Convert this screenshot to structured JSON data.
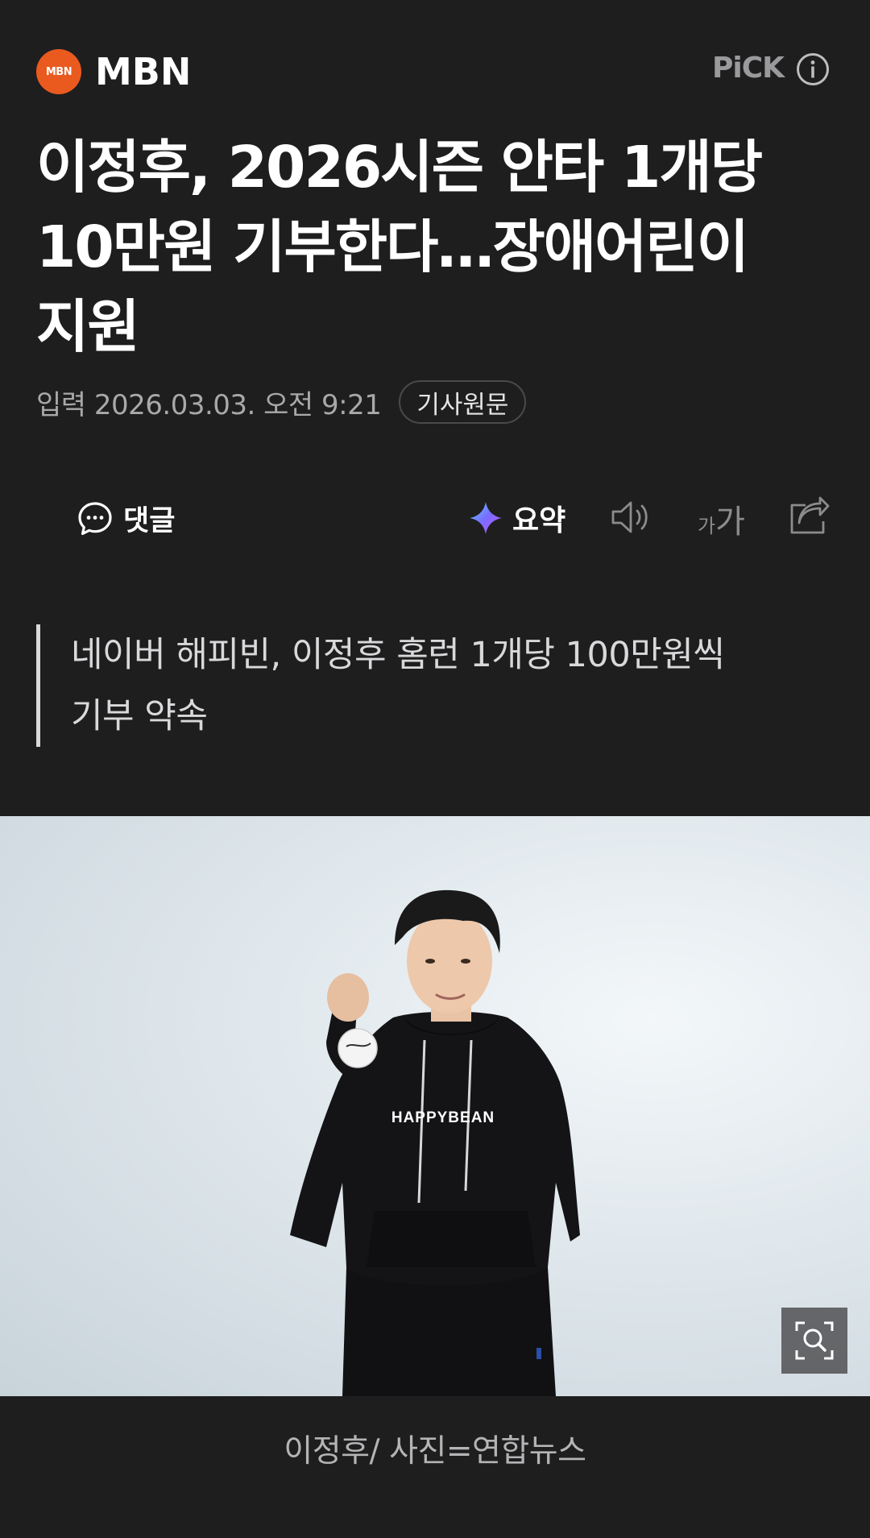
{
  "header": {
    "logo_text": "MBN",
    "press_name": "MBN",
    "pick_label": "PiCK",
    "info_icon": "info-circle-icon"
  },
  "article": {
    "title": "이정후, 2026시즌 안타 1개당\n10만원 기부한다…장애어린이\n지원",
    "date": "입력 2026.03.03. 오전 9:21",
    "origin_button": "기사원문"
  },
  "toolbar": {
    "comment_label": "댓글",
    "summary_label": "요약",
    "font_size_label": "가가",
    "icons": [
      "comment-icon",
      "ai-summary-icon",
      "speaker-icon",
      "font-size-icon",
      "share-icon"
    ]
  },
  "subheading": "네이버 해피빈, 이정후 홈런 1개당 100만원씩\n기부 약속",
  "photo": {
    "shirt_text": "HAPPYBEAN",
    "caption": "이정후/ 사진=연합뉴스",
    "zoom_icon": "zoom-icon"
  },
  "colors": {
    "background": "#1e1e1f",
    "logo_orange": "#ea5a1f",
    "muted_text": "#a9a9ab"
  }
}
